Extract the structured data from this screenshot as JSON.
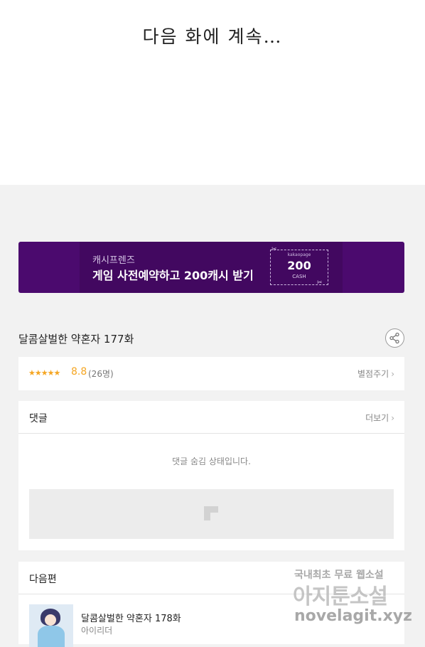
{
  "top": {
    "continue_text": "다음 화에 계속…"
  },
  "banner": {
    "brand": "캐시프렌즈",
    "headline": "게임 사전예약하고 200캐시 받기",
    "coupon_top": "kakaopage",
    "coupon_amount": "200",
    "coupon_unit": "CASH",
    "bg_color": "#4b0a6e"
  },
  "episode": {
    "title": "달콤살벌한 약혼자 177화",
    "share_icon": "share-icon"
  },
  "rating": {
    "stars": "★★★★★",
    "score": "8.8",
    "count": "(26명)",
    "rate_label": "별점주기",
    "star_color": "#f5a623"
  },
  "comments": {
    "label": "댓글",
    "more_label": "더보기",
    "hidden_message": "댓글 숨김 상태입니다."
  },
  "next_episode": {
    "label": "다음편",
    "title": "달콤살벌한 약혼자 178화",
    "author": "아이리더"
  },
  "watermark": {
    "line1": "국내최초 무료 웹소설",
    "line2": "아지툰소설",
    "line3": "novelagit.xyz"
  }
}
